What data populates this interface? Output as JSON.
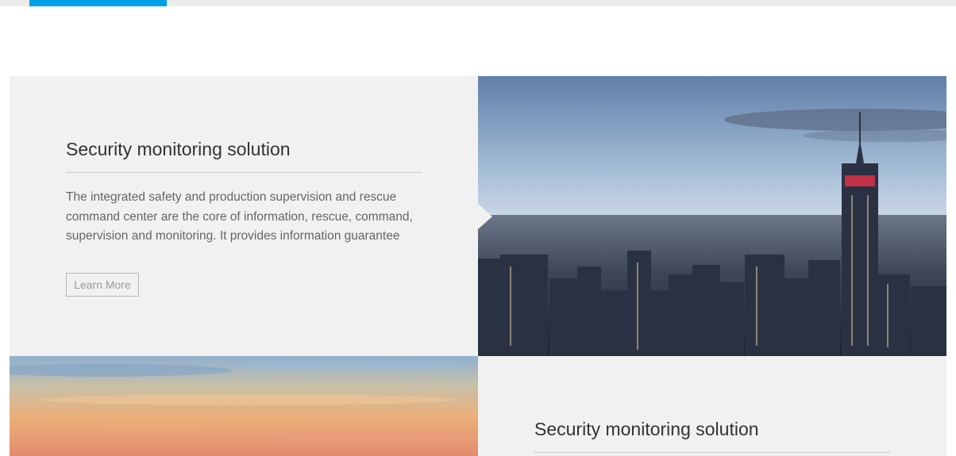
{
  "nav": {
    "active_color": "#00a0e9",
    "bar_color": "#ececec"
  },
  "solutions": [
    {
      "title": "Security monitoring solution",
      "description": "The integrated safety and production supervision and rescue command center are the core of information, rescue, command, supervision and monitoring. It provides information guarantee",
      "button_label": "Learn More",
      "image": "city-skyline-photo"
    },
    {
      "title": "Security monitoring solution",
      "image": "sunset-sky-photo"
    }
  ],
  "colors": {
    "panel_bg": "#f1f1f1",
    "heading": "#333333",
    "text": "#666666"
  }
}
